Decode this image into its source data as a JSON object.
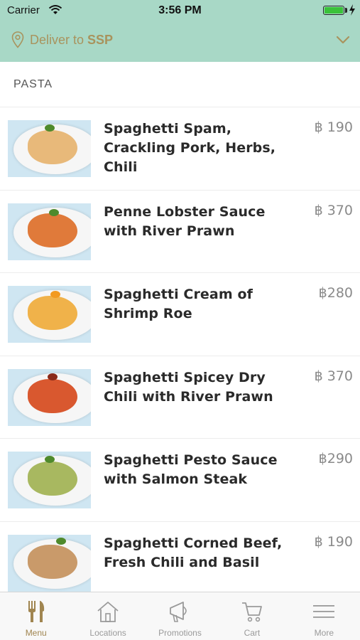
{
  "status_bar": {
    "carrier": "Carrier",
    "time": "3:56 PM"
  },
  "header": {
    "deliver_prefix": "Deliver to ",
    "deliver_location": "SSP"
  },
  "section": {
    "title": "PASTA"
  },
  "items": [
    {
      "name": "Spaghetti Spam, Crackling Pork, Herbs, Chili",
      "price": "฿ 190",
      "food_color": "#e8b97a"
    },
    {
      "name": "Penne Lobster Sauce with River Prawn",
      "price": "฿ 370",
      "food_color": "#e07a3a"
    },
    {
      "name": "Spaghetti Cream of Shrimp Roe",
      "price": "฿280",
      "food_color": "#f0b24a"
    },
    {
      "name": "Spaghetti Spicey Dry Chili with River Prawn",
      "price": "฿ 370",
      "food_color": "#d9582f"
    },
    {
      "name": "Spaghetti Pesto Sauce with Salmon Steak",
      "price": "฿290",
      "food_color": "#a8b860"
    },
    {
      "name": "Spaghetti Corned Beef, Fresh Chili and Basil",
      "price": "฿ 190",
      "food_color": "#c99a6a"
    }
  ],
  "tabs": [
    {
      "label": "Menu",
      "icon": "cutlery-icon",
      "active": true
    },
    {
      "label": "Locations",
      "icon": "house-icon",
      "active": false
    },
    {
      "label": "Promotions",
      "icon": "megaphone-icon",
      "active": false
    },
    {
      "label": "Cart",
      "icon": "cart-icon",
      "active": false
    },
    {
      "label": "More",
      "icon": "menu-lines-icon",
      "active": false
    }
  ],
  "colors": {
    "header_bg": "#a8d8c6",
    "accent_gold": "#a9935d",
    "active_tab": "#a08550"
  }
}
